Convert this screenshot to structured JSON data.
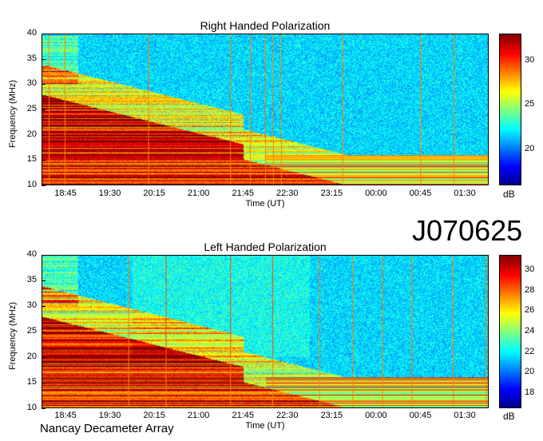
{
  "dataset_id": "J070625",
  "footer_label": "Nancay Decameter Array",
  "chart_data": [
    {
      "type": "heatmap",
      "title": "Right Handed Polarization",
      "xlabel": "Time (UT)",
      "ylabel": "Frequency (MHz)",
      "x_ticks": [
        "18:45",
        "19:30",
        "20:15",
        "21:00",
        "21:45",
        "22:30",
        "23:15",
        "00:00",
        "00:45",
        "01:30"
      ],
      "y_ticks": [
        10,
        15,
        20,
        25,
        30,
        35,
        40
      ],
      "ylim": [
        10,
        40
      ],
      "colorbar_label": "dB",
      "colorbar_ticks": [
        20,
        25,
        30
      ],
      "colorbar_range": [
        16,
        33
      ]
    },
    {
      "type": "heatmap",
      "title": "Left Handed Polarization",
      "xlabel": "Time (UT)",
      "ylabel": "Frequency (MHz)",
      "x_ticks": [
        "18:45",
        "19:30",
        "20:15",
        "21:00",
        "21:45",
        "22:30",
        "23:15",
        "00:00",
        "00:45",
        "01:30"
      ],
      "y_ticks": [
        10,
        15,
        20,
        25,
        30,
        35,
        40
      ],
      "ylim": [
        10,
        40
      ],
      "colorbar_label": "dB",
      "colorbar_ticks": [
        18,
        20,
        22,
        24,
        26,
        28,
        30
      ],
      "colorbar_range": [
        16.5,
        31.5
      ]
    }
  ]
}
